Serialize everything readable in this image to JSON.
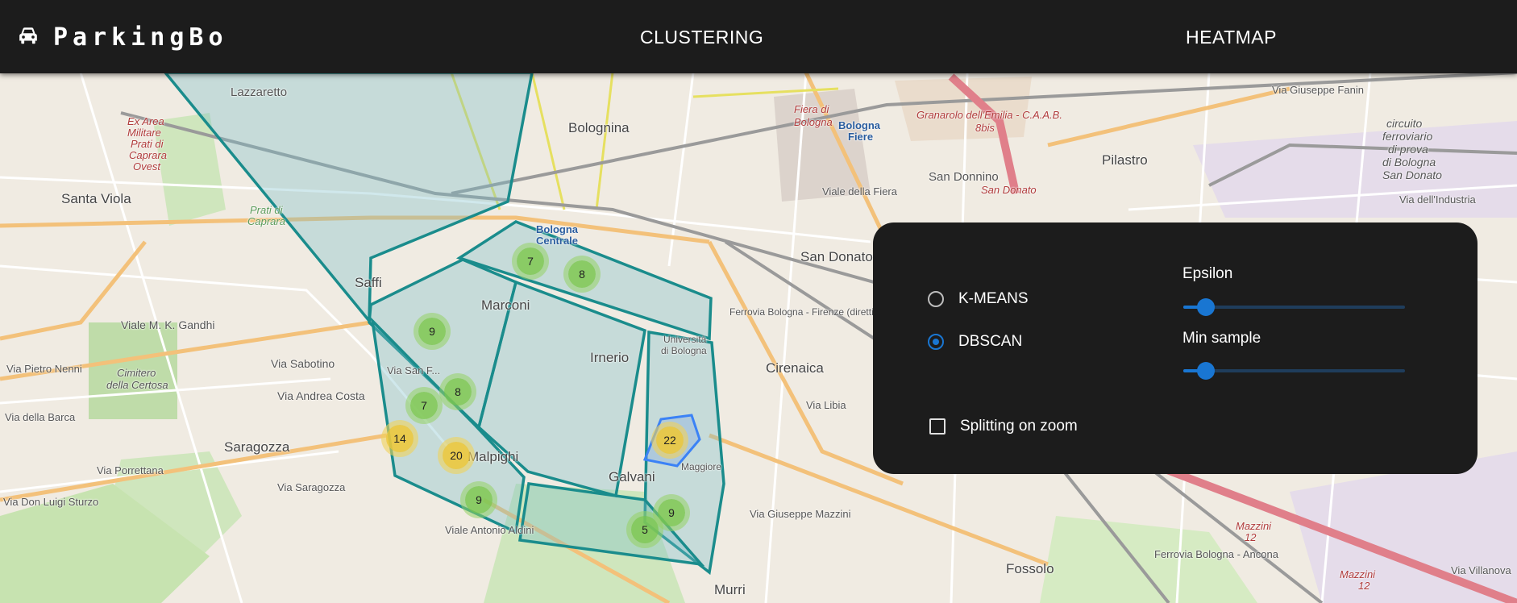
{
  "app": {
    "brand": "ParkingBo",
    "brand_icon": "car-icon"
  },
  "nav": {
    "clustering": "CLUSTERING",
    "heatmap": "HEATMAP"
  },
  "map": {
    "labels": {
      "lazzaretto": "Lazzaretto",
      "bolognina": "Bolognina",
      "fiera_di": "Fiera di",
      "bologna_f": "Bologna",
      "bologna_fiere_1": "Bologna",
      "bologna_fiere_2": "Fiere",
      "granarolo": "Granarolo dell'Emilia - C.A.A.B.",
      "bis": "8bis",
      "pilastro": "Pilastro",
      "san_donnino": "San Donnino",
      "san_donato_red": "San Donato",
      "ex_area_1": "Ex Area",
      "ex_area_2": "Militare",
      "ex_area_3": "Prati di",
      "ex_area_4": "Caprara",
      "ex_area_5": "Ovest",
      "santa_viola": "Santa Viola",
      "prati_di": "Prati di",
      "caprara": "Caprara",
      "bologna_centrale_1": "Bologna",
      "bologna_centrale_2": "Centrale",
      "san_donato": "San Donato",
      "saffi": "Saffi",
      "marconi": "Marconi",
      "irnerio": "Irnerio",
      "universita_1": "Università",
      "universita_2": "di Bologna",
      "cirenaica": "Cirenaica",
      "viale_gandhi": "Viale M. K. Gandhi",
      "via_sabotino": "Via Sabotino",
      "via_andrea_costa": "Via Andrea Costa",
      "cimitero_1": "Cimitero",
      "cimitero_2": "della Certosa",
      "saragozza": "Saragozza",
      "via_saragozza": "Via Saragozza",
      "via_porrettana": "Via Porrettana",
      "via_della_barca": "Via della Barca",
      "via_pietro_nenni": "Via Pietro Nenni",
      "via_don_luigi_sturzo": "Via Don Luigi Sturzo",
      "galvani": "Galvani",
      "malpighi": "Malpighi",
      "via_giuseppe_mazzini": "Via Giuseppe Mazzini",
      "viale_antonio_aldini": "Viale Antonio Aldini",
      "fossolo": "Fossolo",
      "murri": "Murri",
      "circuito_1": "circuito",
      "circuito_2": "ferroviario",
      "circuito_3": "di prova",
      "circuito_4": "di Bologna",
      "circuito_5": "San Donato",
      "via_dell_industria": "Via dell'Industria",
      "via_giuseppe_fanin": "Via Giuseppe Fanin",
      "viale_della_fiera": "Viale della Fiera",
      "ferrovia_bologna_ancona": "Ferrovia Bologna - Ancona",
      "mazzini_12a": "Mazzini",
      "mazzini_12b": "12",
      "mazzini_12c": "Mazzini",
      "mazzini_12d": "12",
      "via_villanova": "Via Villanova",
      "via_libia": "Via Libia",
      "maggiore": "Maggiore",
      "via_san_felice": "Via San F...",
      "ferrovia_bologna_firenze": "Ferrovia Bologna - Firenze (diretti...)"
    },
    "clusters": [
      {
        "count": "7",
        "level": "green"
      },
      {
        "count": "8",
        "level": "green"
      },
      {
        "count": "9",
        "level": "green"
      },
      {
        "count": "8",
        "level": "green"
      },
      {
        "count": "7",
        "level": "green"
      },
      {
        "count": "14",
        "level": "yellow"
      },
      {
        "count": "20",
        "level": "yellow"
      },
      {
        "count": "22",
        "level": "yellow"
      },
      {
        "count": "9",
        "level": "green"
      },
      {
        "count": "9",
        "level": "green"
      },
      {
        "count": "5",
        "level": "green"
      }
    ],
    "colors": {
      "polygon_stroke": "#1a8c8c",
      "polygon_fill": "rgba(120,190,200,0.35)",
      "selected_stroke": "#3b82f6"
    }
  },
  "panel": {
    "algorithms": [
      {
        "label": "K-MEANS",
        "selected": false
      },
      {
        "label": "DBSCAN",
        "selected": true
      }
    ],
    "epsilon": {
      "label": "Epsilon",
      "value": 0.1
    },
    "min_sample": {
      "label": "Min sample",
      "value": 0.1
    },
    "splitting": {
      "label": "Splitting on zoom",
      "checked": false
    },
    "accent_color": "#1976d2"
  }
}
